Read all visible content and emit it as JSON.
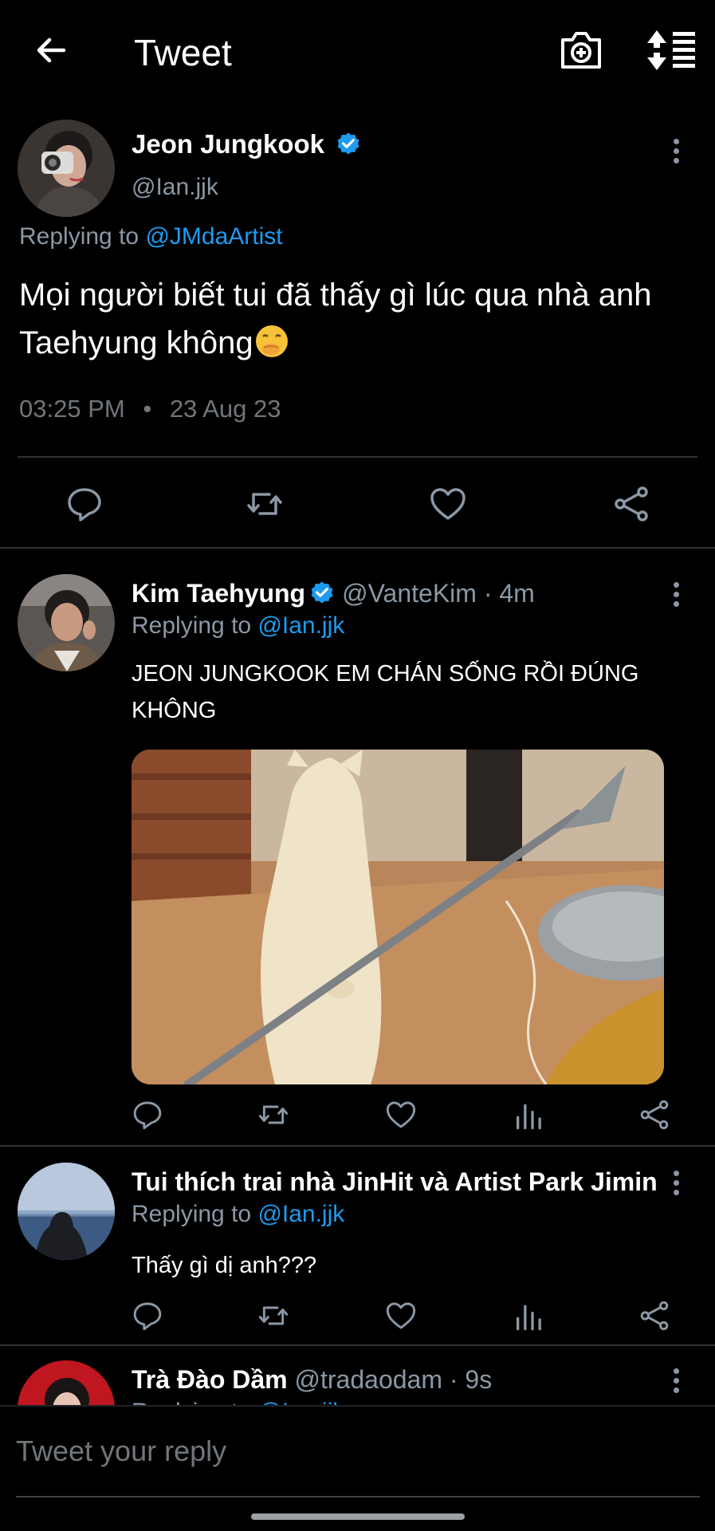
{
  "header": {
    "title": "Tweet",
    "back_icon": "arrow-left-icon",
    "camera_icon": "camera-add-icon",
    "sort_icon": "sort-list-icon"
  },
  "main_tweet": {
    "name": "Jeon Jungkook",
    "handle": "@Ian.jjk",
    "replying_prefix": "Replying to",
    "replying_to": "@JMdaArtist",
    "text": "Mọi người biết tui đã thấy gì lúc qua nhà anh Taehyung không",
    "emoji": "face-with-hand-over-mouth",
    "time": "03:25 PM",
    "dot": "•",
    "date": "23 Aug 23",
    "actions": [
      "reply-icon",
      "retweet-icon",
      "like-icon",
      "share-icon"
    ]
  },
  "replies": [
    {
      "name": "Kim Taehyung",
      "verified": true,
      "handle": "@VanteKim",
      "time": "· 4m",
      "replying_prefix": "Replying to",
      "replying_to": "@Ian.jjk",
      "text": "JEON JUNGKOOK EM CHÁN SỐNG RỒI ĐÚNG KHÔNG",
      "has_media": true,
      "actions": [
        "reply-icon",
        "retweet-icon",
        "like-icon",
        "stats-icon",
        "share-icon"
      ]
    },
    {
      "name": "Tui thích trai nhà JinHit và Artist Park Jimin ...",
      "verified": false,
      "handle": "",
      "time": "",
      "replying_prefix": "Replying to",
      "replying_to": "@Ian.jjk",
      "text": "Thấy gì dị anh???",
      "has_media": false,
      "actions": [
        "reply-icon",
        "retweet-icon",
        "like-icon",
        "stats-icon",
        "share-icon"
      ]
    },
    {
      "name": "Trà Đào Dầm",
      "verified": false,
      "handle": "@tradaodam",
      "time": "· 9s",
      "replying_prefix": "Replying to",
      "replying_to": "@Ian.jjk",
      "text": "",
      "has_media": false,
      "actions": []
    }
  ],
  "composer": {
    "placeholder": "Tweet your reply"
  },
  "colors": {
    "background": "#000000",
    "accent": "#1d9bf0",
    "muted": "#8b98a5",
    "divider": "#2f3336"
  }
}
